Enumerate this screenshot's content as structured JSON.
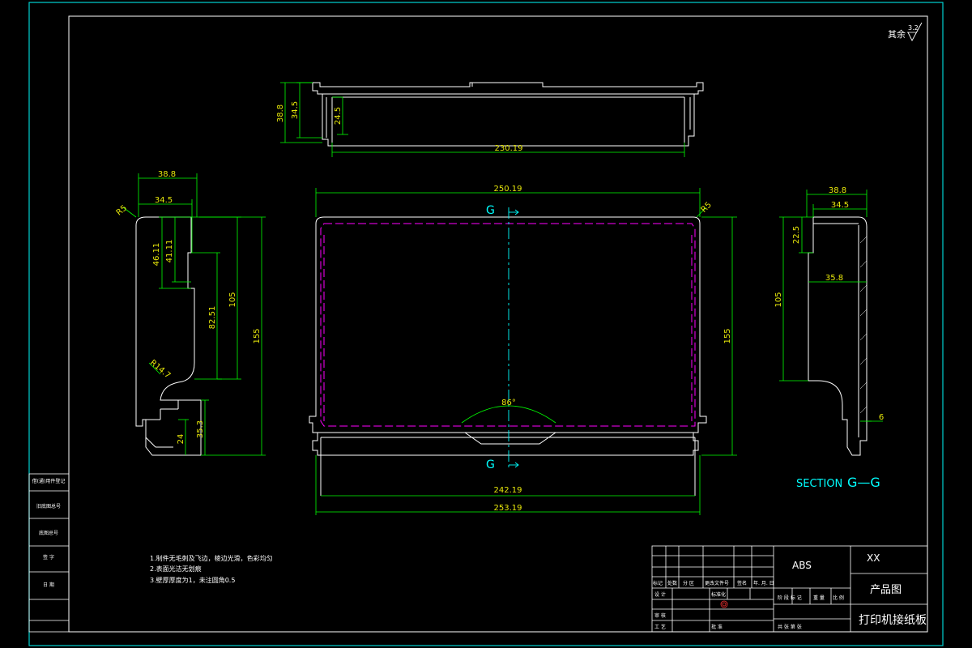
{
  "roughness": {
    "prefix": "其余",
    "value": "3.2"
  },
  "top_view": {
    "dims": [
      "38.8",
      "34.5",
      "24.5",
      "230.19"
    ]
  },
  "front_view": {
    "dims": [
      "250.19",
      "155",
      "242.19",
      "253.19",
      "86°"
    ],
    "radius": "R5",
    "section_letter": "G"
  },
  "left_view": {
    "dims": [
      "38.8",
      "34.5",
      "46.11",
      "41.11",
      "82.51",
      "105",
      "155",
      "35.3",
      "24"
    ],
    "radii": [
      "R5",
      "R14.7"
    ]
  },
  "section_view": {
    "title": "SECTION",
    "letter": "G—G",
    "dims": [
      "38.8",
      "34.5",
      "22.5",
      "35.8",
      "105",
      "6"
    ]
  },
  "notes": [
    "1.制件无毛刺及飞边，棱边光滑，色彩均匀",
    "2.表面光洁无划痕",
    "3.壁厚厚度为1，未注圆角0.5"
  ],
  "left_strip": [
    "借(通)用件登记",
    "旧底图总号",
    "底图总号",
    "签 字",
    "日 期"
  ],
  "title_block": {
    "material": "ABS",
    "company": "XX",
    "drawing_type": "产品图",
    "part_name": "打印机接纸板",
    "row_labels": [
      "标记",
      "处数",
      "分 区",
      "更改文件号",
      "签名",
      "年. 月. 日"
    ],
    "left_labels": [
      "设 计",
      "审 核",
      "工 艺",
      "标准化",
      "批 准"
    ],
    "stage_label": "阶 段 标 记",
    "weight_label": "重 量",
    "scale_label": "比 例",
    "sheets_label": "共 张 第 张"
  },
  "colors": {
    "outline": "#ffffff",
    "dimension": "#00ff00",
    "dimension_text": "#e7e70a",
    "hidden": "#ff00ff",
    "center": "#00ffff",
    "border": "#00ffff"
  }
}
